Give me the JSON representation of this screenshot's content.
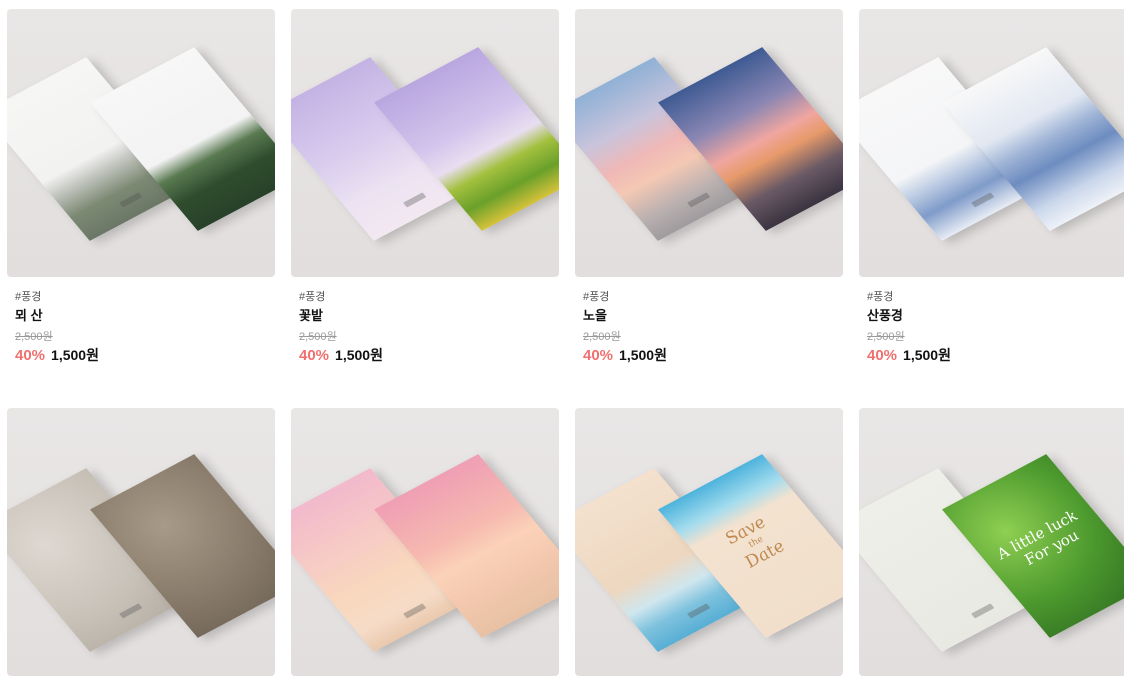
{
  "products": [
    {
      "tag": "#풍경",
      "name": "뫼 산",
      "original_price": "2,500원",
      "discount": "40%",
      "price": "1,500원"
    },
    {
      "tag": "#풍경",
      "name": "꽃밭",
      "original_price": "2,500원",
      "discount": "40%",
      "price": "1,500원"
    },
    {
      "tag": "#풍경",
      "name": "노을",
      "original_price": "2,500원",
      "discount": "40%",
      "price": "1,500원"
    },
    {
      "tag": "#풍경",
      "name": "산풍경",
      "original_price": "2,500원",
      "discount": "40%",
      "price": "1,500원"
    }
  ],
  "row2_card_text": {
    "save_date_line1": "Save",
    "save_date_line2": "the",
    "save_date_line3": "Date",
    "luck_line1": "A little luck",
    "luck_line2": "For you"
  },
  "colors": {
    "discount": "#f0706f",
    "strike": "#9a9a9a",
    "thumb_bg": "#e6e2e2"
  }
}
